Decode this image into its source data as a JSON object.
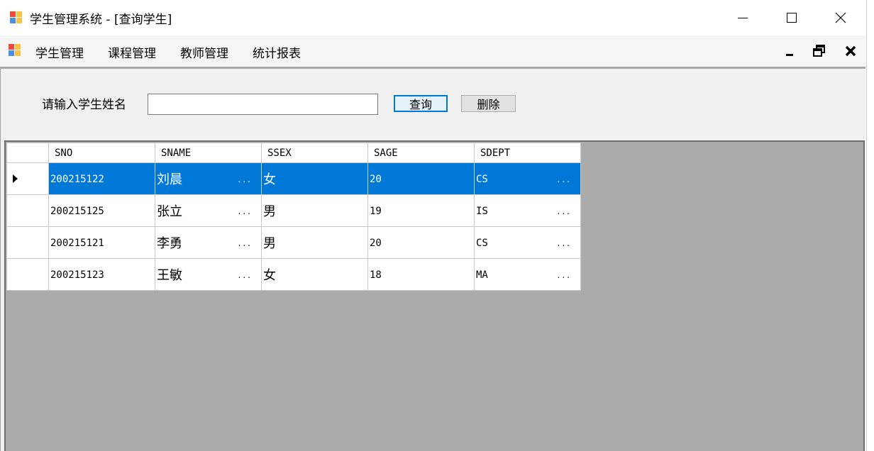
{
  "window": {
    "title": "学生管理系统 - [查询学生]"
  },
  "menubar": {
    "items": [
      "学生管理",
      "课程管理",
      "教师管理",
      "统计报表"
    ]
  },
  "search": {
    "label": "请输入学生姓名",
    "value": "",
    "placeholder": "",
    "query_label": "查询",
    "delete_label": "删除"
  },
  "grid": {
    "columns": [
      "SNO",
      "SNAME",
      "SSEX",
      "SAGE",
      "SDEPT"
    ],
    "selected_row": 0,
    "rows": [
      {
        "sno": "200215122",
        "sname": "刘晨",
        "ssex": "女",
        "sage": "20",
        "sdept": "CS"
      },
      {
        "sno": "200215125",
        "sname": "张立",
        "ssex": "男",
        "sage": "19",
        "sdept": "IS"
      },
      {
        "sno": "200215121",
        "sname": "李勇",
        "ssex": "男",
        "sage": "20",
        "sdept": "CS"
      },
      {
        "sno": "200215123",
        "sname": "王敏",
        "ssex": "女",
        "sage": "18",
        "sdept": "MA"
      }
    ],
    "ellipsis": "..."
  },
  "colors": {
    "selection": "#0078d7",
    "grid_background": "#ababab",
    "client_background": "#f0f0f0"
  },
  "icons": {
    "app": "app-icon",
    "minimize": "minimize-icon",
    "maximize": "maximize-icon",
    "close": "close-icon",
    "mdi_minimize": "mdi-minimize-icon",
    "mdi_restore": "mdi-restore-icon",
    "mdi_close": "mdi-close-icon",
    "row_selector": "row-selector-icon"
  }
}
